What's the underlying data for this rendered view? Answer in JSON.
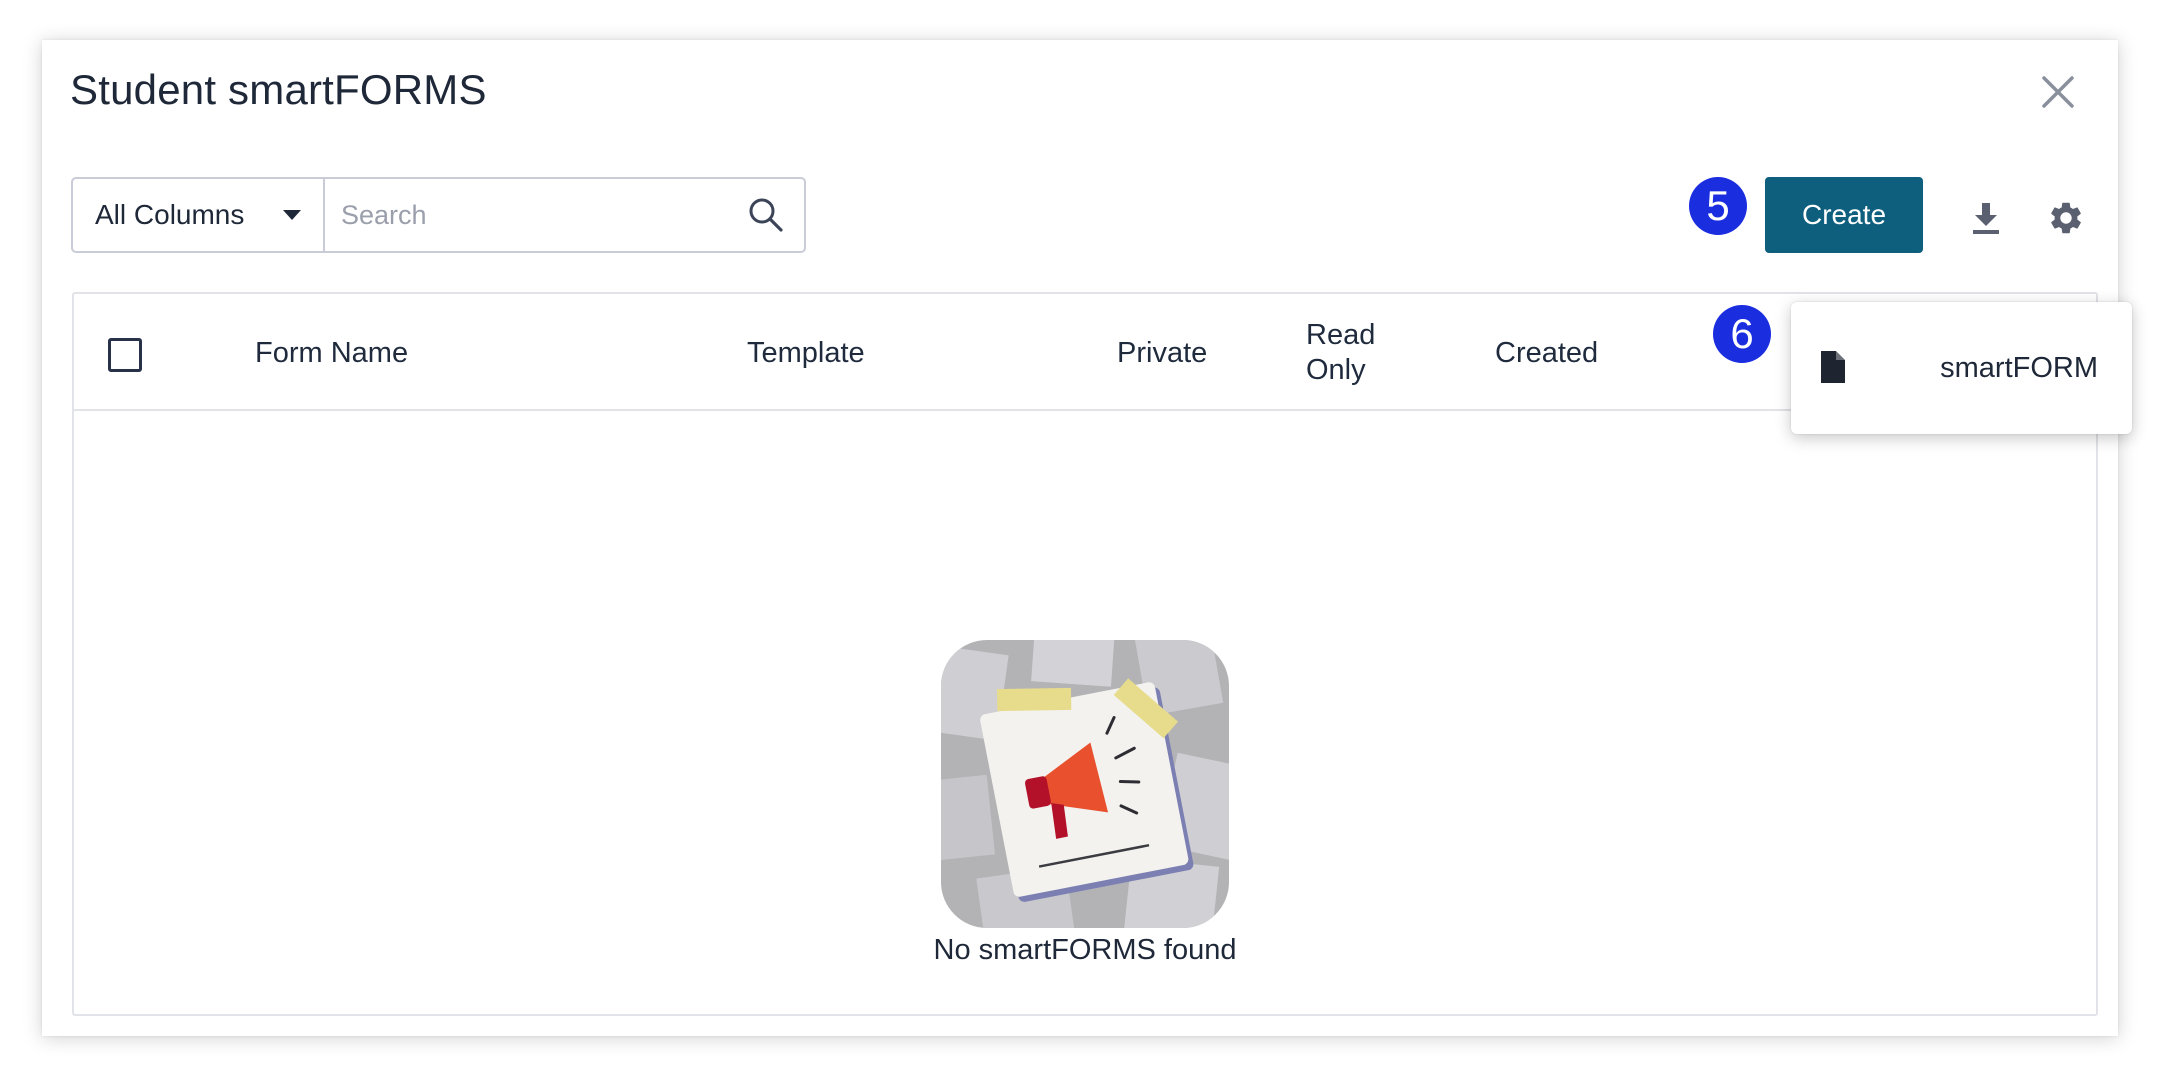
{
  "modal": {
    "title": "Student smartFORMS"
  },
  "toolbar": {
    "column_filter": "All Columns",
    "search_placeholder": "Search",
    "search_value": "",
    "create_label": "Create"
  },
  "annotations": {
    "create_step": "5",
    "menu_step": "6"
  },
  "table": {
    "headers": {
      "form_name": "Form Name",
      "template": "Template",
      "private": "Private",
      "read_only_line1": "Read",
      "read_only_line2": "Only",
      "created": "Created"
    },
    "empty_message": "No smartFORMS found"
  },
  "create_menu": {
    "items": [
      {
        "label": "smartFORM",
        "icon": "document-icon"
      }
    ]
  },
  "icons": {
    "close": "close-icon",
    "search": "search-icon",
    "download": "download-icon",
    "settings": "gear-icon",
    "dropdown": "caret-down-icon"
  },
  "colors": {
    "primary": "#0e5f7e",
    "badge": "#1a2ee0",
    "megaphone": "#e8502e"
  }
}
